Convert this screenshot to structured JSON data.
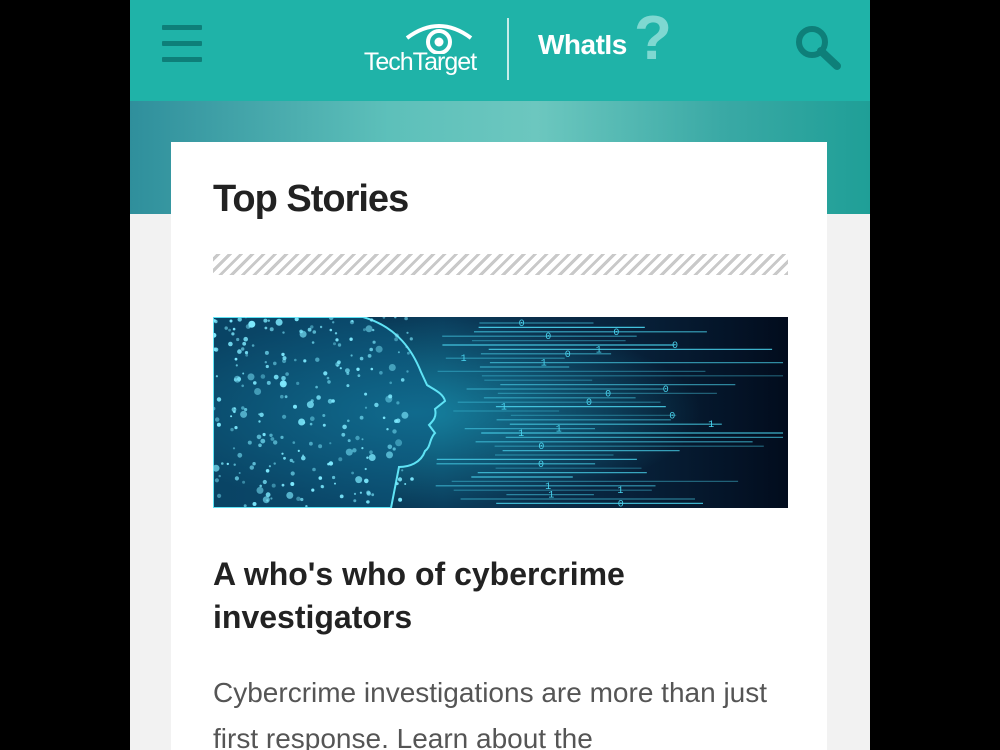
{
  "header": {
    "brand": "TechTarget",
    "site_name": "WhatIs",
    "site_mark": "?",
    "menu_icon": "hamburger-menu-icon",
    "search_icon": "search-icon"
  },
  "colors": {
    "header_bg": "#1fb3a8",
    "icon_dark_teal": "#0e7f79",
    "accent_light_teal": "#7fd8d1"
  },
  "section": {
    "title": "Top Stories"
  },
  "story": {
    "title": "A who's who of cybercrime investigators",
    "description": "Cybercrime investigations are more than just first response. Learn about the"
  }
}
